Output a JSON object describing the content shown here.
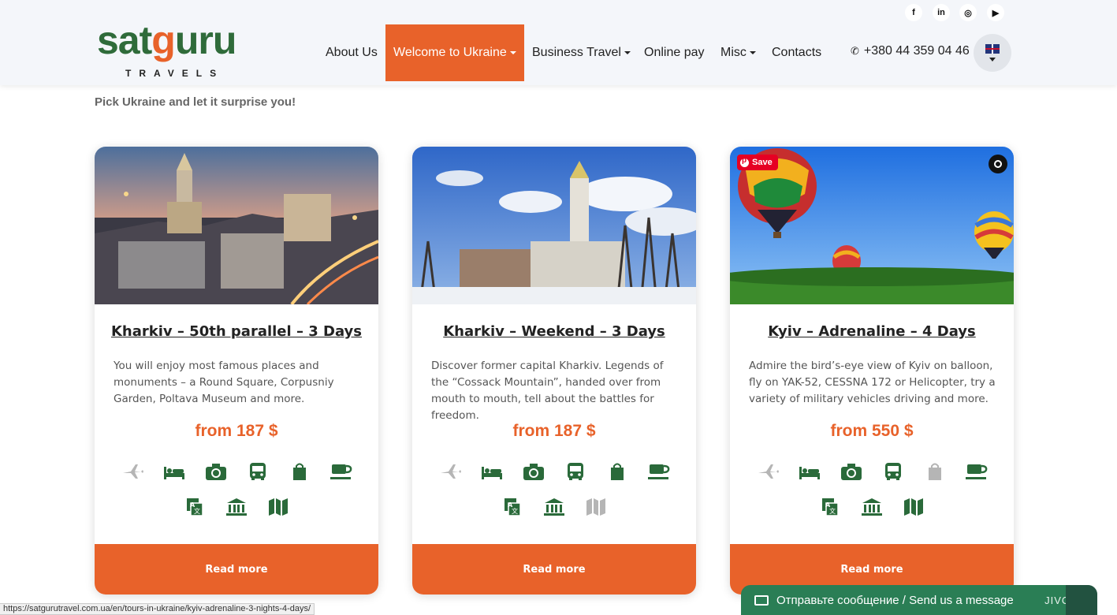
{
  "header": {
    "logo": {
      "brand": "satguru",
      "sub": "TRAVELS"
    },
    "social": [
      "f",
      "in",
      "◎",
      "▶"
    ],
    "nav": [
      {
        "label": "About Us",
        "dropdown": false
      },
      {
        "label": "Welcome to Ukraine",
        "dropdown": true,
        "active": true
      },
      {
        "label": "Business Travel",
        "dropdown": true
      },
      {
        "label": "Online pay",
        "dropdown": false
      },
      {
        "label": "Misc",
        "dropdown": true
      },
      {
        "label": "Contacts",
        "dropdown": false
      }
    ],
    "phone": "+380 44 359 04 46",
    "language": "EN"
  },
  "tagline": "Pick Ukraine and let it surprise you!",
  "cards": [
    {
      "title": "Kharkiv – 50th parallel – 3 Days",
      "description": "You will enjoy most famous places and monuments – a Round Square, Corpusniy Garden, Poltava Museum and more.",
      "price": "from 187 $",
      "read_more": "Read more",
      "amenities_included": {
        "flight": false,
        "hotel": true,
        "photo": true,
        "bus": true,
        "shopping": true,
        "cafe": true,
        "translator": true,
        "museum": true,
        "map": true
      }
    },
    {
      "title": "Kharkiv – Weekend – 3 Days",
      "description": "Discover former capital Kharkiv. Legends of the “Cossack Mountain”, handed over from mouth to mouth, tell about the battles for freedom.",
      "price": "from 187 $",
      "read_more": "Read more",
      "amenities_included": {
        "flight": false,
        "hotel": true,
        "photo": true,
        "bus": true,
        "shopping": true,
        "cafe": true,
        "translator": true,
        "museum": true,
        "map": false
      }
    },
    {
      "title": "Kyiv – Adrenaline – 4 Days",
      "description": "Admire the bird’s-eye view of Kyiv on balloon, fly on YAK-52, CESSNA 172 or Helicopter, try a variety of military vehicles driving and more.",
      "price": "from 550 $",
      "read_more": "Read more",
      "amenities_included": {
        "flight": false,
        "hotel": true,
        "photo": true,
        "bus": true,
        "shopping": false,
        "cafe": true,
        "translator": true,
        "museum": true,
        "map": true
      }
    }
  ],
  "pinterest_save": "Save",
  "status_url": "https://satgurutravel.com.ua/en/tours-in-ukraine/kyiv-adrenaline-3-nights-4-days/",
  "chat": {
    "label": "Отправьте сообщение / Send us a message",
    "brand": "JIVO"
  },
  "colors": {
    "accent": "#e8622a",
    "brand_green": "#2f6b3a",
    "icon_active": "#2a6a3a",
    "icon_inactive": "#b5b5b5",
    "chat_bg": "#2a7e55"
  }
}
